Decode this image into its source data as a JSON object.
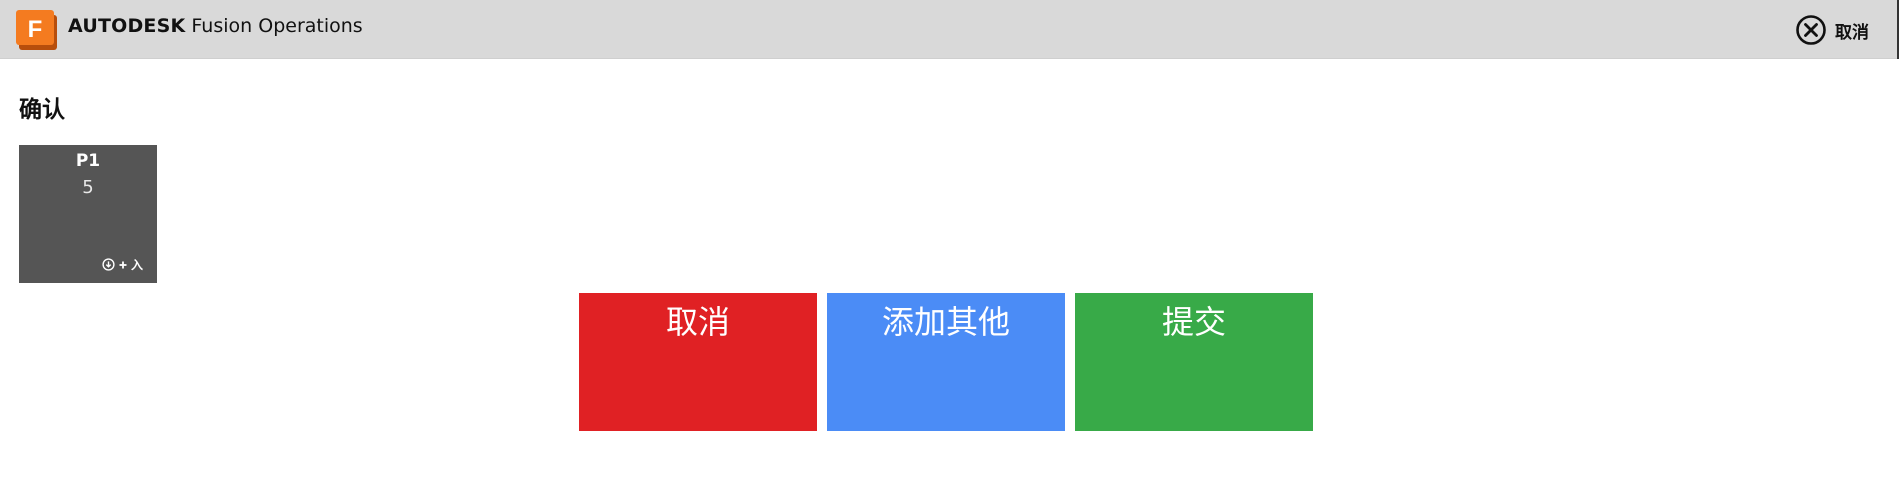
{
  "header": {
    "company": "AUTODESK",
    "product": "Fusion Operations",
    "logo_letter": "F",
    "cancel_label": "取消",
    "cancel_icon": "close-circle-icon"
  },
  "page": {
    "title": "确认"
  },
  "tiles": [
    {
      "name": "P1",
      "quantity": "5",
      "footer_icons": [
        "download-circle-icon",
        "plus-icon"
      ],
      "footer_label": "入"
    }
  ],
  "actions": {
    "cancel_label": "取消",
    "add_other_label": "添加其他",
    "submit_label": "提交"
  },
  "colors": {
    "header_bg": "#d9d9d9",
    "logo_orange": "#f47b20",
    "tile_bg": "#555555",
    "cancel_red": "#e02124",
    "add_blue": "#4b8cf6",
    "submit_green": "#38aa48"
  }
}
